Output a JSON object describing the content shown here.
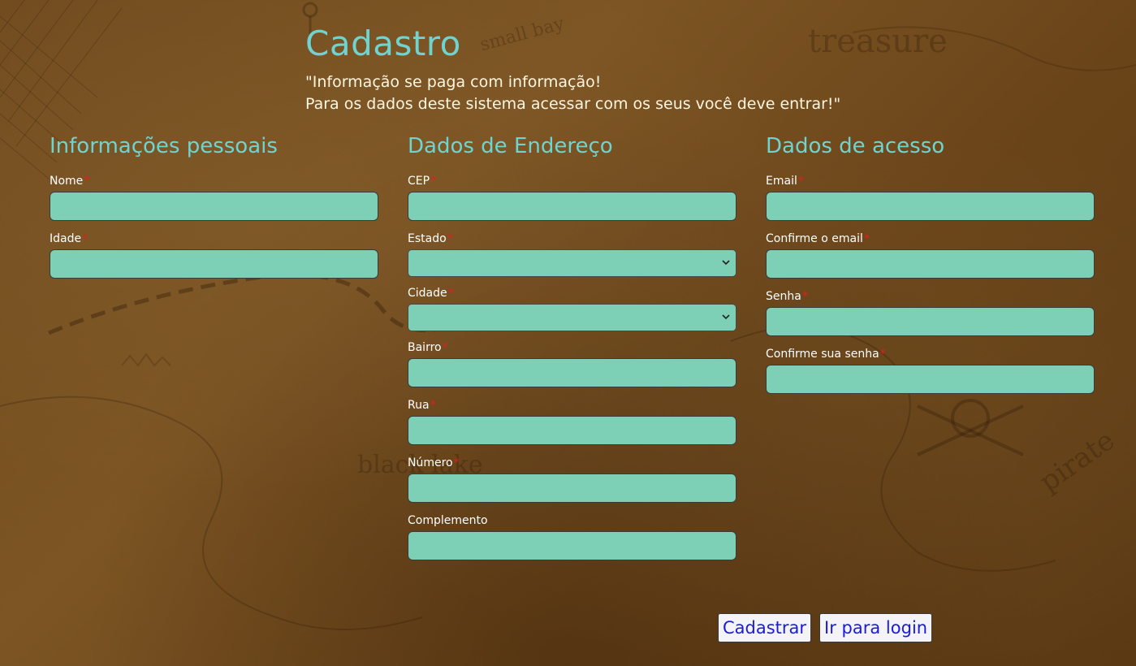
{
  "header": {
    "title": "Cadastro",
    "quote_line1": "\"Informação se paga com informação!",
    "quote_line2": "Para os dados deste sistema acessar com os seus você deve entrar!\""
  },
  "background_words": [
    "treasure",
    "small bay",
    "black lake",
    "pirate"
  ],
  "sections": {
    "personal": {
      "title": "Informações pessoais",
      "fields": {
        "name": {
          "label": "Nome",
          "value": ""
        },
        "age": {
          "label": "Idade",
          "value": ""
        }
      }
    },
    "address": {
      "title": "Dados de Endereço",
      "fields": {
        "cep": {
          "label": "CEP",
          "value": ""
        },
        "state": {
          "label": "Estado",
          "value": ""
        },
        "city": {
          "label": "Cidade",
          "value": ""
        },
        "neighborhood": {
          "label": "Bairro",
          "value": ""
        },
        "street": {
          "label": "Rua",
          "value": ""
        },
        "number": {
          "label": "Número",
          "value": ""
        },
        "complement": {
          "label": "Complemento",
          "value": ""
        }
      }
    },
    "access": {
      "title": "Dados de acesso",
      "fields": {
        "email": {
          "label": "Email",
          "value": ""
        },
        "email_confirm": {
          "label": "Confirme o email",
          "value": ""
        },
        "password": {
          "label": "Senha",
          "value": ""
        },
        "password_confirm": {
          "label": "Confirme sua senha",
          "value": ""
        }
      }
    }
  },
  "required_marker": "*",
  "actions": {
    "register_label": "Cadastrar",
    "login_label": "Ir para login"
  },
  "colors": {
    "accent": "#6fd3d0",
    "field_bg": "#7dcfb6",
    "required": "#e02020",
    "button_text": "#1a1ae0",
    "background": "#6f4a1d"
  }
}
